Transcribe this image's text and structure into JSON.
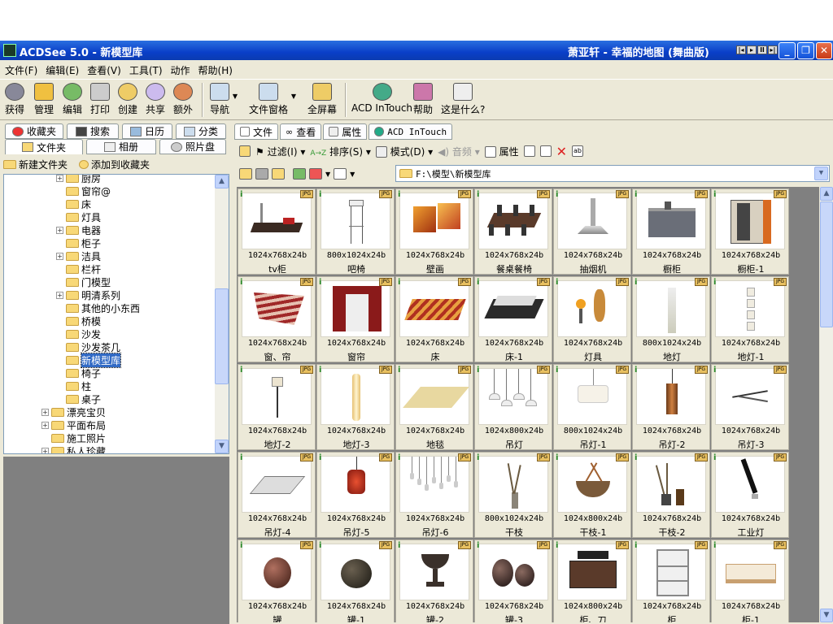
{
  "window": {
    "title": "ACDSee 5.0 - 新模型库",
    "now_playing": "萧亚轩 - 幸福的地图 (舞曲版)"
  },
  "menu": [
    "文件(F)",
    "编辑(E)",
    "查看(V)",
    "工具(T)",
    "动作",
    "帮助(H)"
  ],
  "toolbar": {
    "acquire": "获得",
    "manage": "管理",
    "edit": "编辑",
    "print": "打印",
    "create": "创建",
    "share": "共享",
    "extra": "额外",
    "navigate": "导航",
    "file_pane": "文件窗格",
    "fullscreen": "全屏幕",
    "intouch": "ACD InTouch",
    "help": "帮助",
    "whatsthis": "这是什么?"
  },
  "left_tabs": {
    "favorites": "收藏夹",
    "search": "搜索",
    "calendar": "日历",
    "category": "分类",
    "folders": "文件夹",
    "album": "相册",
    "photo_disc": "照片盘"
  },
  "folder_bar": {
    "new_folder": "新建文件夹",
    "add_favorite": "添加到收藏夹"
  },
  "tree": [
    {
      "label": "厨房",
      "expandable": true,
      "indent": 1
    },
    {
      "label": "窗帘@",
      "expandable": false,
      "indent": 1
    },
    {
      "label": "床",
      "expandable": false,
      "indent": 1
    },
    {
      "label": "灯具",
      "expandable": false,
      "indent": 1
    },
    {
      "label": "电器",
      "expandable": true,
      "indent": 1
    },
    {
      "label": "柜子",
      "expandable": false,
      "indent": 1
    },
    {
      "label": "洁具",
      "expandable": true,
      "indent": 1
    },
    {
      "label": "栏杆",
      "expandable": false,
      "indent": 1
    },
    {
      "label": "门模型",
      "expandable": false,
      "indent": 1
    },
    {
      "label": "明清系列",
      "expandable": true,
      "indent": 1
    },
    {
      "label": "其他的小东西",
      "expandable": false,
      "indent": 1
    },
    {
      "label": "桥模",
      "expandable": false,
      "indent": 1
    },
    {
      "label": "沙发",
      "expandable": false,
      "indent": 1
    },
    {
      "label": "沙发茶几",
      "expandable": false,
      "indent": 1
    },
    {
      "label": "新模型库",
      "expandable": false,
      "indent": 1,
      "selected": true
    },
    {
      "label": "椅子",
      "expandable": false,
      "indent": 1
    },
    {
      "label": "柱",
      "expandable": false,
      "indent": 1
    },
    {
      "label": "桌子",
      "expandable": false,
      "indent": 1
    },
    {
      "label": "漂亮宝贝",
      "expandable": true,
      "indent": 0
    },
    {
      "label": "平面布局",
      "expandable": true,
      "indent": 0
    },
    {
      "label": "施工照片",
      "expandable": false,
      "indent": 0
    },
    {
      "label": "私人珍藏",
      "expandable": true,
      "indent": 0
    }
  ],
  "right_tabs": {
    "file": "文件",
    "view": "查看",
    "properties": "属性",
    "intouch": "ACD InTouch"
  },
  "file_toolbar": {
    "filter": "过滤(I)",
    "sort": "排序(S)",
    "mode": "模式(D)",
    "audio": "音频",
    "properties": "属性"
  },
  "address": {
    "path": "F:\\模型\\新模型库"
  },
  "thumbs": [
    {
      "dims": "1024x768x24b",
      "name": "tv柜",
      "kind": "tv"
    },
    {
      "dims": "800x1024x24b",
      "name": "吧椅",
      "kind": "stool"
    },
    {
      "dims": "1024x768x24b",
      "name": "壁画",
      "kind": "painting"
    },
    {
      "dims": "1024x768x24b",
      "name": "餐桌餐椅",
      "kind": "dining"
    },
    {
      "dims": "1024x768x24b",
      "name": "抽烟机",
      "kind": "hood"
    },
    {
      "dims": "1024x768x24b",
      "name": "橱柜",
      "kind": "kitchen"
    },
    {
      "dims": "1024x768x24b",
      "name": "橱柜-1",
      "kind": "cabinet"
    },
    {
      "dims": "1024x768x24b",
      "name": "窗、帘",
      "kind": "blind"
    },
    {
      "dims": "1024x768x24b",
      "name": "窗帘",
      "kind": "curtain"
    },
    {
      "dims": "1024x768x24b",
      "name": "床",
      "kind": "bed"
    },
    {
      "dims": "1024x768x24b",
      "name": "床-1",
      "kind": "bed2"
    },
    {
      "dims": "1024x768x24b",
      "name": "灯具",
      "kind": "lamps"
    },
    {
      "dims": "800x1024x24b",
      "name": "地灯",
      "kind": "floorlamp"
    },
    {
      "dims": "1024x768x24b",
      "name": "地灯-1",
      "kind": "column"
    },
    {
      "dims": "1024x768x24b",
      "name": "地灯-2",
      "kind": "standlamp"
    },
    {
      "dims": "1024x768x24b",
      "name": "地灯-3",
      "kind": "tall"
    },
    {
      "dims": "1024x768x24b",
      "name": "地毯",
      "kind": "rug"
    },
    {
      "dims": "1024x800x24b",
      "name": "吊灯",
      "kind": "pendants"
    },
    {
      "dims": "800x1024x24b",
      "name": "吊灯-1",
      "kind": "drum"
    },
    {
      "dims": "1024x768x24b",
      "name": "吊灯-2",
      "kind": "cylinder"
    },
    {
      "dims": "1024x768x24b",
      "name": "吊灯-3",
      "kind": "modern"
    },
    {
      "dims": "1024x768x24b",
      "name": "吊灯-4",
      "kind": "panel"
    },
    {
      "dims": "1024x768x24b",
      "name": "吊灯-5",
      "kind": "lantern"
    },
    {
      "dims": "1024x768x24b",
      "name": "吊灯-6",
      "kind": "multi"
    },
    {
      "dims": "800x1024x24b",
      "name": "干枝",
      "kind": "branch"
    },
    {
      "dims": "1024x800x24b",
      "name": "干枝-1",
      "kind": "bowl"
    },
    {
      "dims": "1024x768x24b",
      "name": "干枝-2",
      "kind": "branch2"
    },
    {
      "dims": "1024x768x24b",
      "name": "工业灯",
      "kind": "industrial"
    },
    {
      "dims": "1024x768x24b",
      "name": "罐",
      "kind": "urn"
    },
    {
      "dims": "1024x768x24b",
      "name": "罐-1",
      "kind": "urn2"
    },
    {
      "dims": "1024x768x24b",
      "name": "罐-2",
      "kind": "chalice"
    },
    {
      "dims": "1024x768x24b",
      "name": "罐-3",
      "kind": "urns"
    },
    {
      "dims": "1024x800x24b",
      "name": "柜、刀",
      "kind": "dresser"
    },
    {
      "dims": "1024x768x24b",
      "name": "柜",
      "kind": "shelf"
    },
    {
      "dims": "1024x768x24b",
      "name": "柜-1",
      "kind": "sideboard"
    }
  ]
}
